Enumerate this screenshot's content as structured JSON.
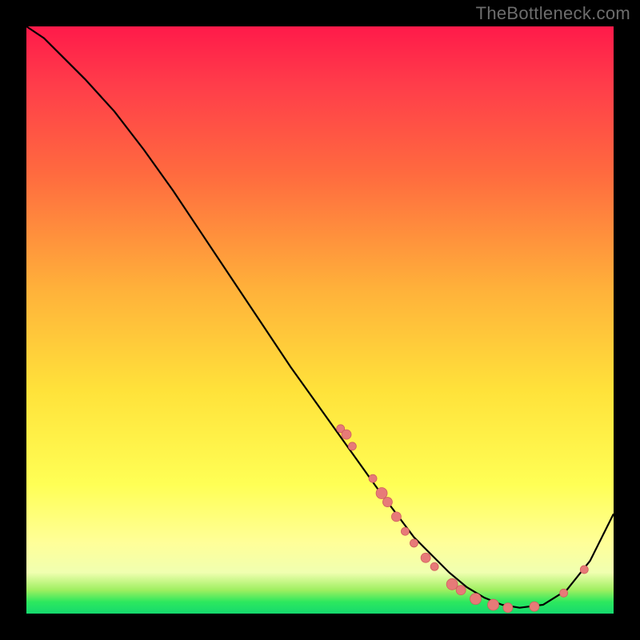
{
  "watermark": "TheBottleneck.com",
  "colors": {
    "frame": "#000000",
    "curve": "#000000",
    "marker_fill": "#e77a78",
    "marker_stroke": "#cf5f5d"
  },
  "chart_data": {
    "type": "line",
    "title": "",
    "xlabel": "",
    "ylabel": "",
    "xlim": [
      0,
      100
    ],
    "ylim": [
      0,
      100
    ],
    "grid": false,
    "series": [
      {
        "name": "bottleneck-curve",
        "x": [
          0,
          3,
          6,
          10,
          15,
          20,
          25,
          30,
          35,
          40,
          45,
          50,
          55,
          60,
          63,
          66,
          69,
          72,
          75,
          78,
          81,
          84,
          88,
          92,
          96,
          100
        ],
        "y": [
          100,
          98,
          95,
          91,
          85.5,
          79,
          72,
          64.5,
          57,
          49.5,
          42,
          35,
          28,
          21,
          17,
          13,
          10,
          7,
          4.5,
          2.7,
          1.5,
          1,
          1.5,
          4,
          9,
          17
        ]
      }
    ],
    "markers": [
      {
        "x": 53.5,
        "y": 31.5,
        "r": 5
      },
      {
        "x": 54.5,
        "y": 30.5,
        "r": 6
      },
      {
        "x": 55.5,
        "y": 28.5,
        "r": 5
      },
      {
        "x": 59.0,
        "y": 23.0,
        "r": 5
      },
      {
        "x": 60.5,
        "y": 20.5,
        "r": 7
      },
      {
        "x": 61.5,
        "y": 19.0,
        "r": 6
      },
      {
        "x": 63.0,
        "y": 16.5,
        "r": 6
      },
      {
        "x": 64.5,
        "y": 14.0,
        "r": 5
      },
      {
        "x": 66.0,
        "y": 12.0,
        "r": 5
      },
      {
        "x": 68.0,
        "y": 9.5,
        "r": 6
      },
      {
        "x": 69.5,
        "y": 8.0,
        "r": 5
      },
      {
        "x": 72.5,
        "y": 5.0,
        "r": 7
      },
      {
        "x": 74.0,
        "y": 4.0,
        "r": 6
      },
      {
        "x": 76.5,
        "y": 2.5,
        "r": 7
      },
      {
        "x": 79.5,
        "y": 1.5,
        "r": 7
      },
      {
        "x": 82.0,
        "y": 1.0,
        "r": 6
      },
      {
        "x": 86.5,
        "y": 1.2,
        "r": 6
      },
      {
        "x": 91.5,
        "y": 3.5,
        "r": 5
      },
      {
        "x": 95.0,
        "y": 7.5,
        "r": 5
      }
    ]
  }
}
